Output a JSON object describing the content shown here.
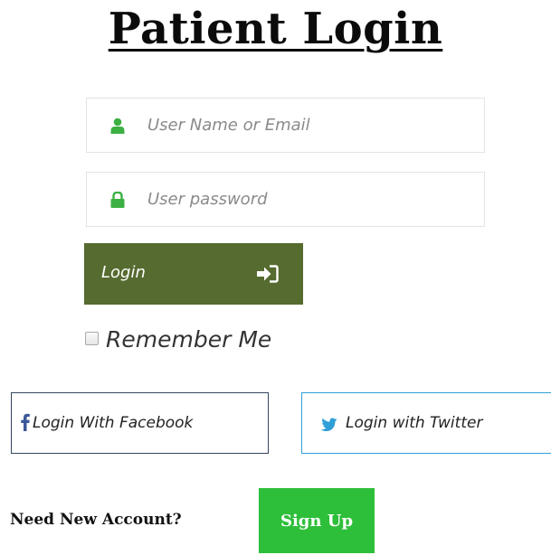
{
  "page": {
    "title": "Patient Login"
  },
  "form": {
    "username_placeholder": "User Name or Email",
    "password_placeholder": "User password",
    "login_label": "Login",
    "remember_label": "Remember Me",
    "remember_checked": false
  },
  "social": {
    "facebook_label": "Login With Facebook",
    "twitter_label": "Login with Twitter"
  },
  "signup": {
    "prompt": "Need New Account?",
    "button_label": "Sign Up"
  },
  "icons": {
    "user": "user-icon",
    "lock": "lock-icon",
    "login": "sign-in-icon",
    "facebook": "facebook-icon",
    "twitter": "twitter-icon"
  },
  "colors": {
    "field_icon": "#3cb043",
    "login_button": "#556b2f",
    "signup_button": "#2ebf3a",
    "facebook": "#3b5998",
    "twitter": "#2f9fd8"
  }
}
